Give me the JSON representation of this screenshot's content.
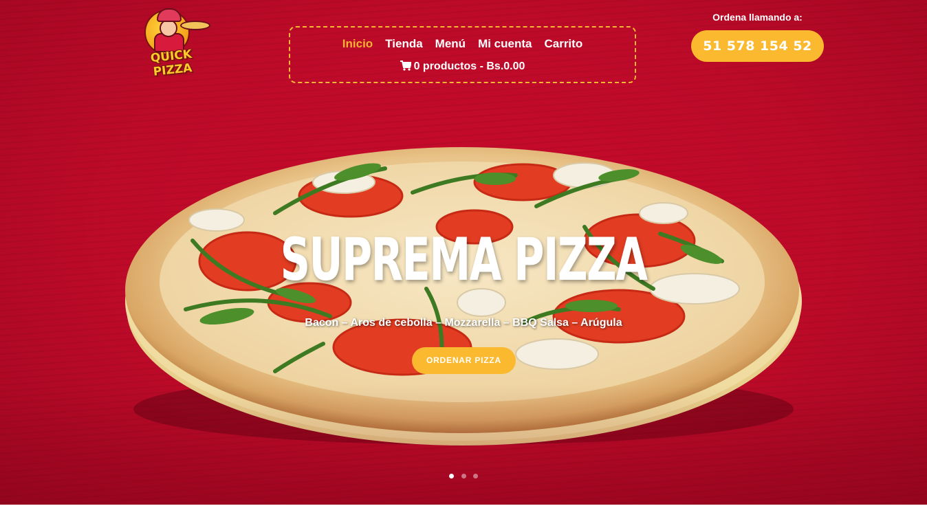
{
  "brand": {
    "logo_text": "QUICK PIZZA"
  },
  "nav": {
    "items": [
      {
        "label": "Inicio",
        "active": true
      },
      {
        "label": "Tienda",
        "active": false
      },
      {
        "label": "Menú",
        "active": false
      },
      {
        "label": "Mi cuenta",
        "active": false
      },
      {
        "label": "Carrito",
        "active": false
      }
    ],
    "cart": {
      "icon": "cart-icon",
      "text": "0 productos - Bs.0.00"
    }
  },
  "contact": {
    "label": "Ordena llamando a:",
    "phone": "51 578 154 52"
  },
  "slider": {
    "title": "SUPREMA PIZZA",
    "subtitle": "Bacon – Aros de cebolla – Mozzarella – BBQ Salsa – Arúgula",
    "button": "ORDENAR PIZZA",
    "slide_count": 3,
    "active_slide": 1
  },
  "colors": {
    "background_red": "#c0092a",
    "accent_yellow": "#fbb92f",
    "text_white": "#ffffff"
  }
}
